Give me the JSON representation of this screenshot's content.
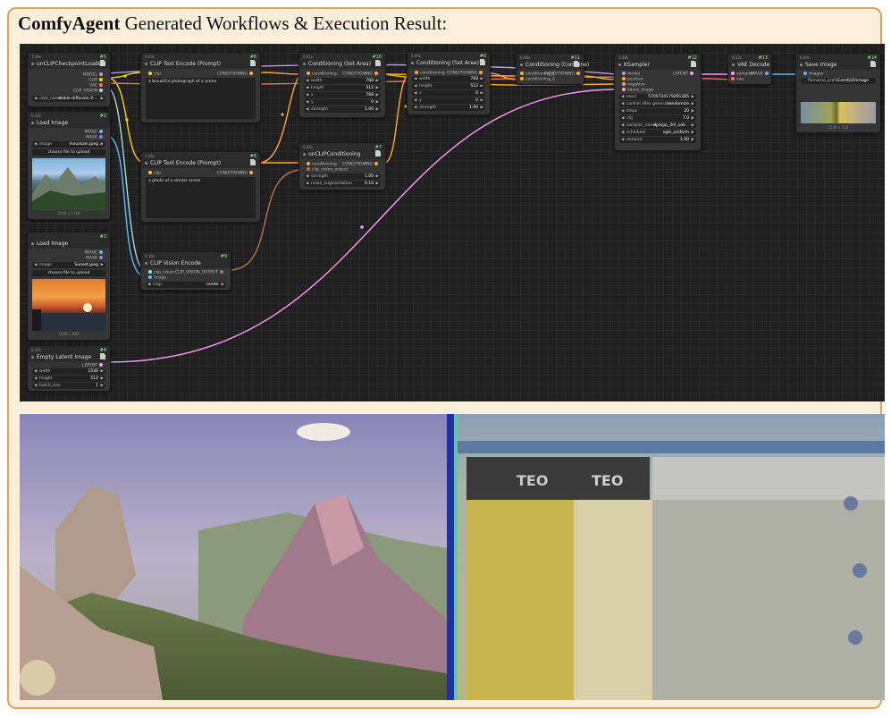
{
  "caption": {
    "brand": "ComfyAgent",
    "rest": " Generated Workflows & Execution Result:"
  },
  "nodes": {
    "loader": {
      "time": "7.49s",
      "id": "#1",
      "title": "unCLIPCheckpointLoader",
      "outs": [
        "MODEL",
        "CLIP",
        "VAE",
        "CLIP_VISION"
      ],
      "w_label": "ckpt_name",
      "w_value": "stable-diffusion-2-..."
    },
    "clip1": {
      "time": "0.03s",
      "id": "#6",
      "title": "CLIP Text Encode (Prompt)",
      "in": "clip",
      "out": "CONDITIONING",
      "text": "a beautiful photograph of a scene"
    },
    "clip2": {
      "time": "0.04s",
      "id": "#6",
      "title": "CLIP Text Encode (Prompt)",
      "in": "clip",
      "out": "CONDITIONING",
      "text": "a photo of a similar scene"
    },
    "csa1": {
      "time": "0.01s",
      "id": "#10",
      "title": "Conditioning (Set Area)",
      "in": "conditioning",
      "out": "CONDITIONING",
      "widgets": [
        {
          "l": "width",
          "v": "768"
        },
        {
          "l": "height",
          "v": "512"
        },
        {
          "l": "x",
          "v": "768"
        },
        {
          "l": "y",
          "v": "0"
        },
        {
          "l": "strength",
          "v": "1.00"
        }
      ]
    },
    "csa2": {
      "time": "0.00s",
      "id": "#8",
      "title": "Conditioning (Set Area)",
      "in": "conditioning",
      "out": "CONDITIONING",
      "widgets": [
        {
          "l": "width",
          "v": "768"
        },
        {
          "l": "height",
          "v": "512"
        },
        {
          "l": "x",
          "v": "0"
        },
        {
          "l": "y",
          "v": "0"
        },
        {
          "l": "strength",
          "v": "1.00"
        }
      ]
    },
    "combine": {
      "time": "0.00s",
      "id": "#11",
      "title": "Conditioning (Combine)",
      "ins": [
        "conditioning_1",
        "conditioning_2"
      ],
      "out": "CONDITIONING"
    },
    "ksampler": {
      "time": "3.58s",
      "id": "#12",
      "title": "KSampler",
      "ins": [
        "model",
        "positive",
        "negative",
        "latent_image"
      ],
      "out": "LATENT",
      "widgets": [
        {
          "l": "seed",
          "v": "570073417929138​5"
        },
        {
          "l": "control after generate",
          "v": "randomize"
        },
        {
          "l": "steps",
          "v": "20"
        },
        {
          "l": "cfg",
          "v": "7.0"
        },
        {
          "l": "sampler_name",
          "v": "dpmpp_3m_sde..."
        },
        {
          "l": "scheduler",
          "v": "sgm_uniform"
        },
        {
          "l": "denoise",
          "v": "1.00"
        }
      ]
    },
    "vae": {
      "time": "0.12s",
      "id": "#13",
      "title": "VAE Decode",
      "ins": [
        "samples",
        "vae"
      ],
      "out": "IMAGE"
    },
    "save": {
      "time": "0.00s",
      "id": "#14",
      "title": "Save Image",
      "in": "images",
      "w_label": "filename_prefix",
      "w_value": "ComfyUI/image",
      "res": "1536 x 512"
    },
    "load1": {
      "time": "0.10s",
      "id": "#2",
      "title": "Load Image",
      "outs": [
        "IMAGE",
        "MASK"
      ],
      "w_label": "image",
      "w_value": "mountain.jpeg",
      "btn": "choose file to upload",
      "res": "2048 x 1366"
    },
    "load2": {
      "time": "",
      "id": "#3",
      "title": "Load Image",
      "outs": [
        "IMAGE",
        "MASK"
      ],
      "w_label": "image",
      "w_value": "Sunset.jpeg",
      "btn": "choose file to upload",
      "res": "1024 x 683"
    },
    "unclip": {
      "time": "0.02s",
      "id": "#7",
      "title": "unCLIPConditioning",
      "ins": [
        "conditioning",
        "clip_vision_output"
      ],
      "out": "CONDITIONING",
      "widgets": [
        {
          "l": "strength",
          "v": "1.00"
        },
        {
          "l": "noise_augmentation",
          "v": "0.10"
        }
      ]
    },
    "cvenc": {
      "time": "0.14s",
      "id": "#9",
      "title": "CLIP Vision Encode",
      "ins": [
        "clip_vision",
        "image"
      ],
      "out": "CLIP_VISION_OUTPUT",
      "w_label": "crop",
      "w_value": "center"
    },
    "latent": {
      "time": "0.00s",
      "id": "#4",
      "title": "Empty Latent Image",
      "out": "LATENT",
      "widgets": [
        {
          "l": "width",
          "v": "1536"
        },
        {
          "l": "height",
          "v": "512"
        },
        {
          "l": "batch_size",
          "v": "1"
        }
      ]
    }
  },
  "colors": {
    "clip": "#ffd500",
    "conditioning": "#ffa931",
    "latent": "#ff9cf9",
    "vae": "#ff6e6e",
    "image": "#64b5f6",
    "model": "#b39ddb",
    "clip_vision": "#a8dadc",
    "clip_vision_output": "#ad7452"
  }
}
